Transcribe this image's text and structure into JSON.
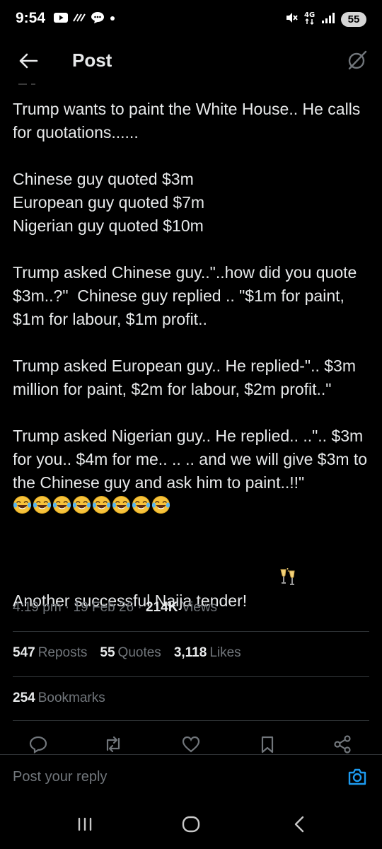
{
  "status_bar": {
    "time": "9:54",
    "left_icons": [
      "youtube-icon",
      "signal-waves-icon",
      "chat-bubble-icon",
      "dot-icon"
    ],
    "right_icons": [
      "mute-icon",
      "4g-icon",
      "signal-bars-icon"
    ],
    "network": "4G",
    "battery": "55"
  },
  "header": {
    "title": "Post",
    "back_icon": "arrow-left-icon",
    "grok_icon": "grok-icon"
  },
  "tweet": {
    "paragraphs": [
      "Trump wants to paint the White House.. He calls for quotations......",
      "Chinese guy quoted $3m\nEuropean guy quoted $7m\nNigerian guy quoted $10m",
      "Trump asked Chinese guy..\"..how did you quote $3m..?\"  Chinese guy replied .. \"$1m for paint, $1m for labour, $1m profit..",
      "Trump asked European guy.. He replied-\".. $3m million for paint, $2m for labour, $2m profit..\"",
      "Trump asked Nigerian guy.. He replied.. ..\".. $3m for you.. $4m for me.. .. .. and we will give $3m to the Chinese guy and ask him to paint..!!\" ",
      "Another successful Naija tender! "
    ],
    "laugh_emoji_count": 8,
    "laugh_emoji": "tears-of-joy-icon",
    "cheers_emoji": "clinking-glasses-icon"
  },
  "meta": {
    "time": "4:19 pm",
    "sep1": " · ",
    "date": "19 Feb 26",
    "sep2": " · ",
    "views_count": "214K",
    "views_label": " Views"
  },
  "stats": {
    "reposts_count": "547",
    "reposts_label": "Reposts",
    "quotes_count": "55",
    "quotes_label": "Quotes",
    "likes_count": "3,118",
    "likes_label": "Likes",
    "bookmarks_count": "254",
    "bookmarks_label": "Bookmarks"
  },
  "actions": [
    "reply-icon",
    "repost-icon",
    "like-icon",
    "bookmark-icon",
    "share-icon"
  ],
  "reply_bar": {
    "placeholder": "Post your reply",
    "camera_icon": "camera-icon"
  },
  "nav_bar": [
    "recents-icon",
    "home-icon",
    "back-icon"
  ],
  "colors": {
    "background": "#000000",
    "text": "#e7e9ea",
    "muted": "#71767b",
    "divider": "#2f3336",
    "accent": "#1d9bf0"
  }
}
